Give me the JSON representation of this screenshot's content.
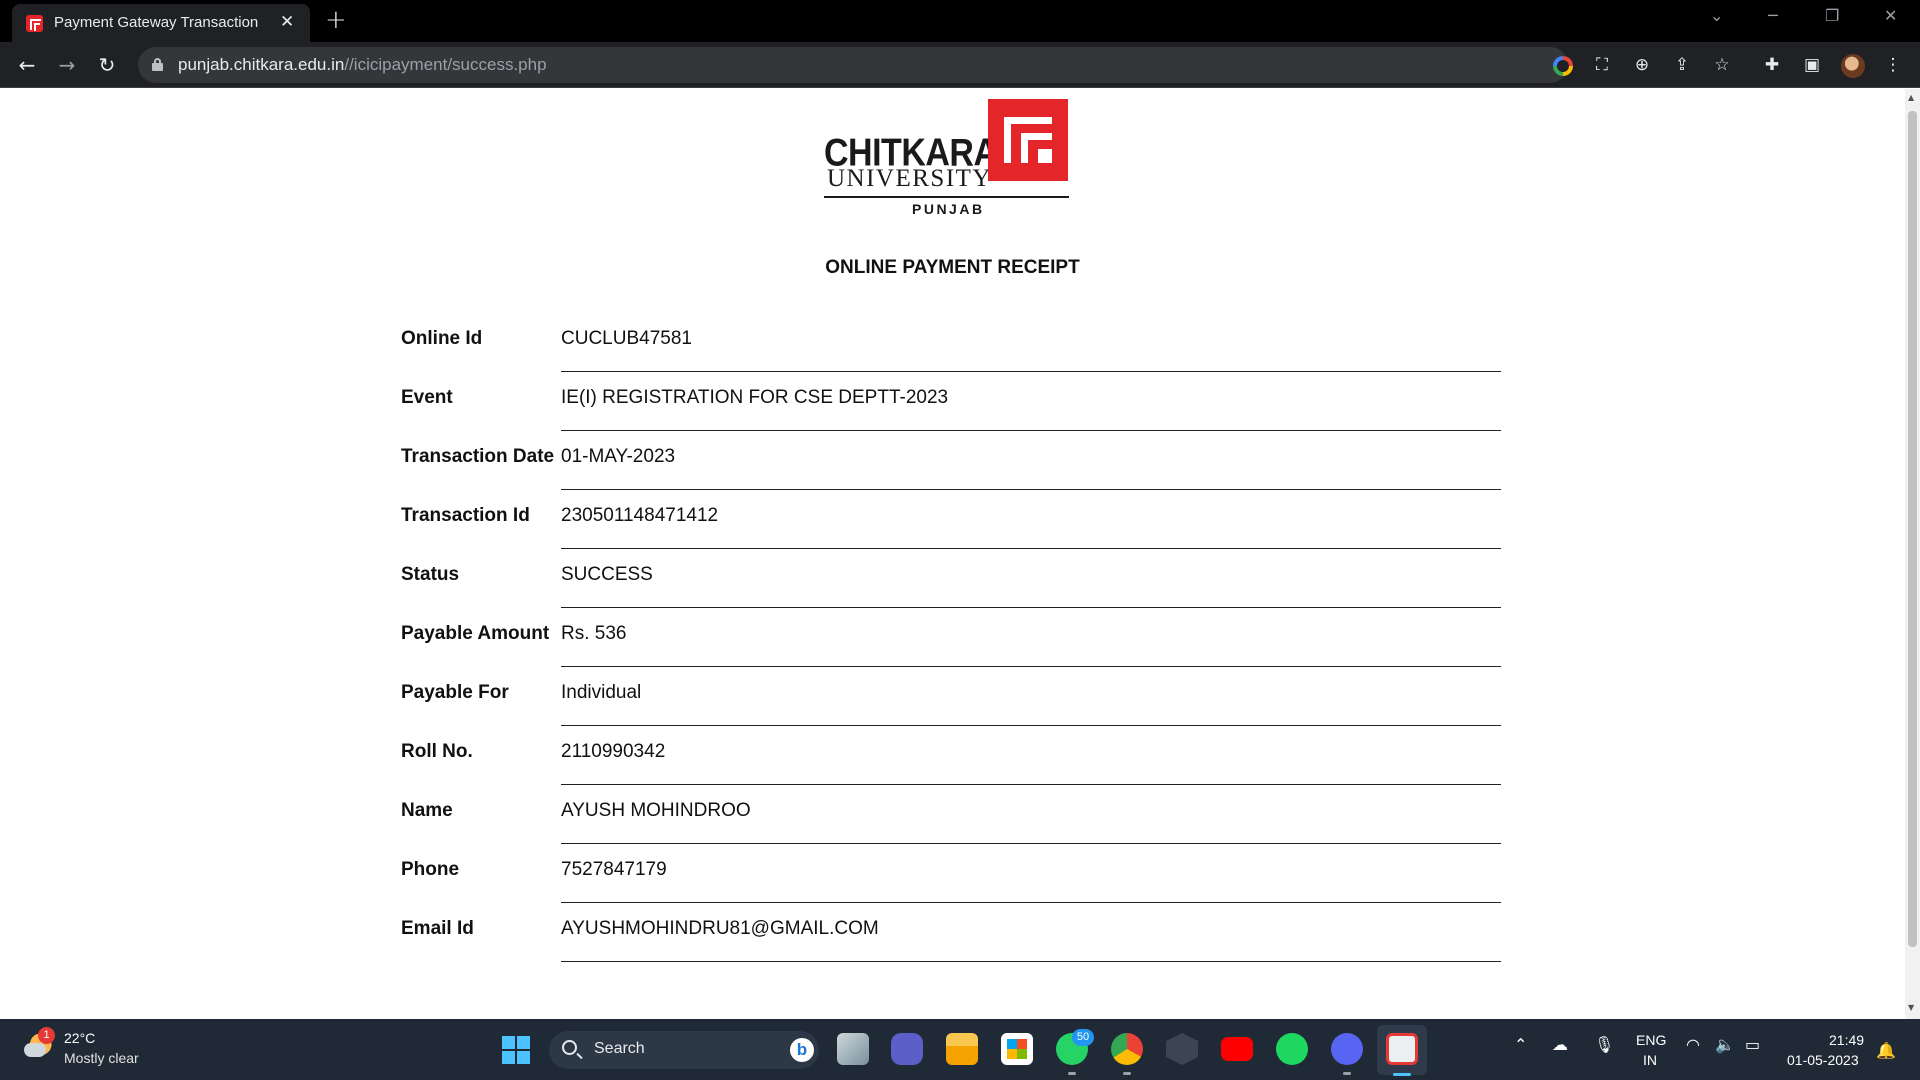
{
  "browser": {
    "tab_title": "Payment Gateway Transaction",
    "url_host": "punjab.chitkara.edu.in",
    "url_path": "//icicipayment/success.php"
  },
  "logo": {
    "name": "CHITKARA",
    "university": "UNIVERSITY",
    "campus": "PUNJAB",
    "brand_color": "#e4252a"
  },
  "receipt": {
    "title": "ONLINE PAYMENT RECEIPT",
    "rows": [
      {
        "label": "Online Id",
        "value": "CUCLUB47581"
      },
      {
        "label": "Event",
        "value": "IE(I) REGISTRATION FOR CSE DEPTT-2023"
      },
      {
        "label": "Transaction Date",
        "value": "01-MAY-2023"
      },
      {
        "label": "Transaction Id",
        "value": "230501148471412"
      },
      {
        "label": "Status",
        "value": "SUCCESS"
      },
      {
        "label": "Payable Amount",
        "value": "Rs. 536"
      },
      {
        "label": "Payable For",
        "value": "Individual"
      },
      {
        "label": "Roll No.",
        "value": "2110990342"
      },
      {
        "label": "Name",
        "value": "AYUSH MOHINDROO"
      },
      {
        "label": "Phone",
        "value": "7527847179"
      },
      {
        "label": "Email Id",
        "value": "AYUSHMOHINDRU81@GMAIL.COM"
      }
    ]
  },
  "taskbar": {
    "weather_temp": "22°C",
    "weather_desc": "Mostly clear",
    "weather_badge": "1",
    "search_label": "Search",
    "whatsapp_badge": "50",
    "lang_top": "ENG",
    "lang_bottom": "IN",
    "time": "21:49",
    "date": "01-05-2023"
  },
  "icons": {
    "accent": "#4cc2ff",
    "toolbar": [
      "back-icon",
      "forward-icon",
      "reload-icon",
      "google-lens-icon",
      "translate-icon",
      "zoom-icon",
      "share-icon",
      "bookmark-star-icon",
      "extensions-icon",
      "side-panel-icon",
      "profile-avatar",
      "menu-icon"
    ]
  }
}
